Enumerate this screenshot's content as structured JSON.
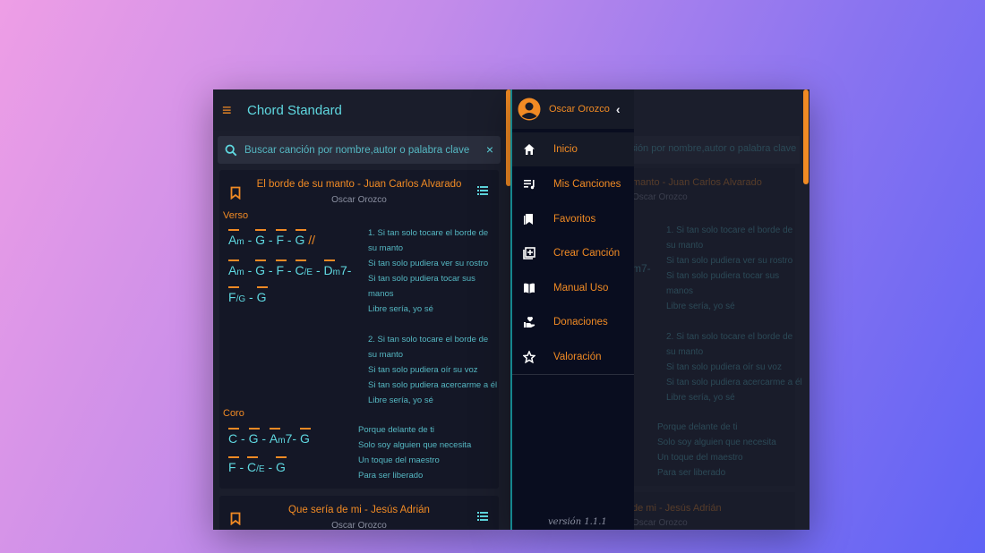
{
  "app": {
    "title": "Chord Standard",
    "search_placeholder": "Buscar canción por nombre,autor o palabra clave",
    "clear_label": "×",
    "accent_color": "#f08a24",
    "text_color": "#5fd8e0"
  },
  "songs": [
    {
      "title": "El borde de su manto - Juan Carlos Alvarado",
      "author": "Oscar Orozco",
      "verse_label": "Verso",
      "verse_chords": [
        "Am - G - F - G //",
        "Am - G - F - C/E - Dm7-",
        "F/G - G"
      ],
      "verse_lyrics": [
        "1. Si tan solo tocare el borde de",
        "su manto",
        "Si tan solo pudiera ver su rostro",
        "Si tan solo pudiera tocar sus",
        "manos",
        "Libre sería, yo sé",
        "2. Si tan solo tocare el borde de",
        "su manto",
        "Si tan solo pudiera oír su voz",
        "Si tan solo pudiera acercarme a él",
        "Libre sería, yo sé"
      ],
      "chorus_label": "Coro",
      "chorus_chords": [
        "C - G - Am7- G",
        "F - C/E - G"
      ],
      "chorus_lyrics": [
        "Porque delante de ti",
        "Solo soy alguien que necesita",
        "Un toque del maestro",
        "Para ser liberado"
      ]
    },
    {
      "title": "Que sería de mi - Jesús Adrián",
      "author": "Oscar Orozco"
    }
  ],
  "drawer": {
    "user_name": "Oscar Orozco",
    "items": [
      {
        "label": "Inicio",
        "icon": "home-icon"
      },
      {
        "label": "Mis Canciones",
        "icon": "playlist-icon"
      },
      {
        "label": "Favoritos",
        "icon": "bookmark-icon"
      },
      {
        "label": "Crear Canción",
        "icon": "add-box-icon"
      },
      {
        "label": "Manual Uso",
        "icon": "book-icon"
      },
      {
        "label": "Donaciones",
        "icon": "donate-hand-icon"
      },
      {
        "label": "Valoración",
        "icon": "star-icon"
      }
    ],
    "version": "versión 1.1.1"
  },
  "background_dimmed": {
    "search_placeholder": "ción por nombre,autor o palabra clave",
    "song1_title": "manto - Juan Carlos Alvarado",
    "song1_author": "Oscar Orozco",
    "chord_fragment": "m7-",
    "verse_lyrics": [
      "1. Si tan solo tocare el borde de",
      "su manto",
      "Si tan solo pudiera ver su rostro",
      "Si tan solo pudiera tocar sus",
      "manos",
      "Libre sería, yo sé",
      "2. Si tan solo tocare el borde de",
      "su manto",
      "Si tan solo pudiera oír su voz",
      "Si tan solo pudiera acercarme a él",
      "Libre sería, yo sé"
    ],
    "chorus_lyrics": [
      "Porque delante de ti",
      "Solo soy alguien que necesita",
      "Un toque del maestro",
      "Para ser liberado"
    ],
    "song2_title": "de mi - Jesús Adrián",
    "song2_author": "Oscar Orozco"
  }
}
